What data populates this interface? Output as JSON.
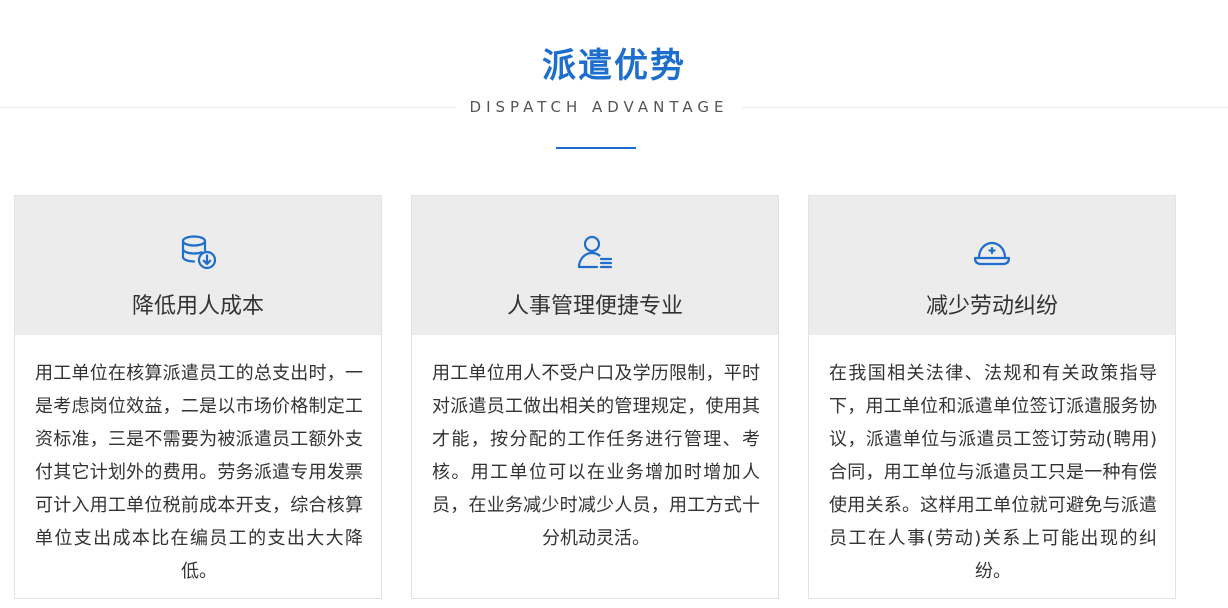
{
  "header": {
    "title": "派遣优势",
    "subtitle": "DISPATCH ADVANTAGE"
  },
  "colors": {
    "accent": "#1e6fcd",
    "card_head_bg": "#ececec"
  },
  "cards": [
    {
      "icon": "database-download-icon",
      "title": "降低用人成本",
      "body": "用工单位在核算派遣员工的总支出时，一是考虑岗位效益，二是以市场价格制定工资标准，三是不需要为被派遣员工额外支付其它计划外的费用。劳务派遣专用发票可计入用工单位税前成本开支，综合核算单位支出成本比在编员工的支出大大降低。"
    },
    {
      "icon": "user-list-icon",
      "title": "人事管理便捷专业",
      "body": "用工单位用人不受户口及学历限制，平时对派遣员工做出相关的管理规定，使用其才能，按分配的工作任务进行管理、考核。用工单位可以在业务增加时增加人员，在业务减少时减少人员，用工方式十分机动灵活。"
    },
    {
      "icon": "helmet-icon",
      "title": "减少劳动纠纷",
      "body": "在我国相关法律、法规和有关政策指导下，用工单位和派遣单位签订派遣服务协议，派遣单位与派遣员工签订劳动(聘用)合同，用工单位与派遣员工只是一种有偿使用关系。这样用工单位就可避免与派遣员工在人事(劳动)关系上可能出现的纠纷。"
    }
  ]
}
